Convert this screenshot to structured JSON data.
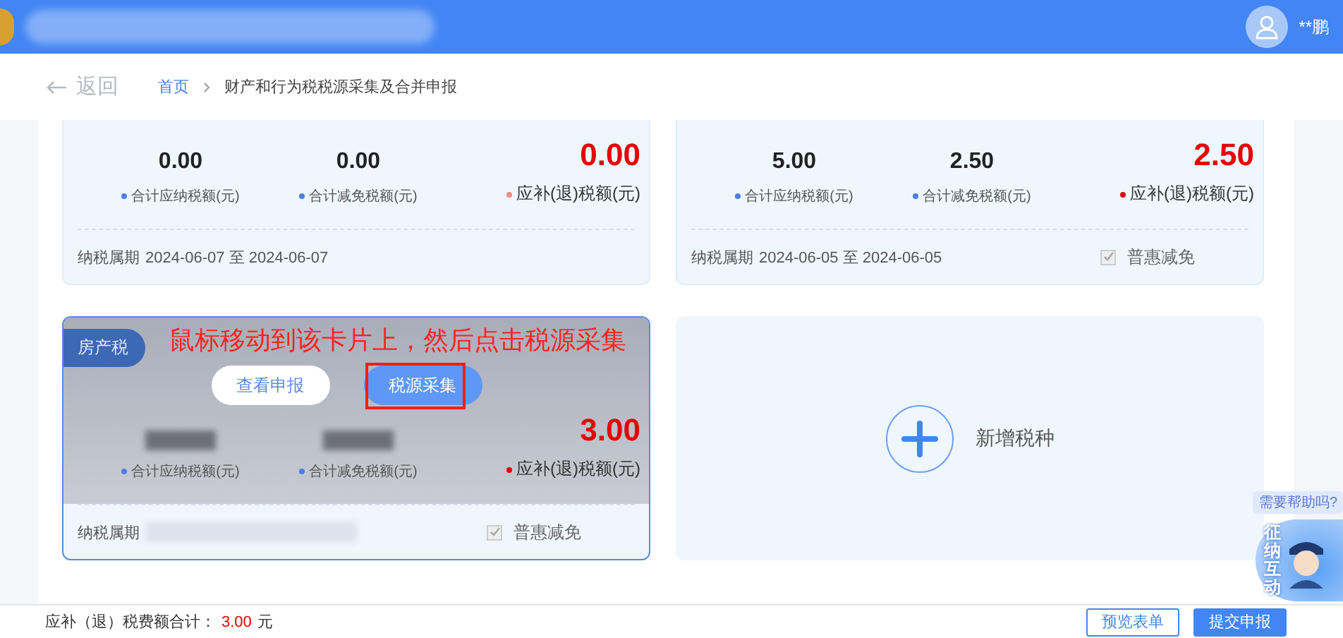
{
  "header": {
    "user_name": "**鹏"
  },
  "back": {
    "label": "返回"
  },
  "breadcrumb": [
    {
      "label": "首页",
      "kind": "link"
    },
    {
      "label": "财产和行为税税源采集及合并申报",
      "kind": "current"
    }
  ],
  "cards": [
    {
      "kind": "tax",
      "hovered": false,
      "payable": "0.00",
      "payable_label": "合计应纳税额(元)",
      "reduced": "0.00",
      "reduced_label": "合计减免税额(元)",
      "due": "0.00",
      "due_label": "应补(退)税额(元)",
      "color": "#f28b82",
      "period_label": "纳税属期",
      "period": "2024-06-07 至 2024-06-07"
    },
    {
      "kind": "tax",
      "hovered": false,
      "payable": "5.00",
      "payable_label": "合计应纳税额(元)",
      "reduced": "2.50",
      "reduced_label": "合计减免税额(元)",
      "due": "2.50",
      "due_label": "应补(退)税额(元)",
      "color": "#e60000",
      "period_label": "纳税属期",
      "period": "2024-06-05 至 2024-06-05",
      "relief": {
        "label": "普惠减免",
        "checked": true
      }
    },
    {
      "kind": "tax",
      "hovered": true,
      "name": "房产税",
      "payable_label": "合计应纳税额(元)",
      "reduced_label": "合计减免税额(元)",
      "due": "3.00",
      "due_label": "应补(退)税额(元)",
      "color": "#e60000",
      "period_label": "纳税属期",
      "relief": {
        "label": "普惠减免",
        "checked": true
      },
      "actions": [
        {
          "label": "查看申报",
          "kind": "secondary",
          "highlighted": false
        },
        {
          "label": "税源采集",
          "kind": "primary",
          "highlighted": true
        }
      ],
      "annotation": {
        "text": "鼠标移动到该卡片上，然后点击税源采集"
      }
    },
    {
      "kind": "add",
      "label": "新增税种"
    }
  ],
  "footer": {
    "total_label": "应补（退）税费额合计：",
    "total": "3.00",
    "unit": "元",
    "buttons": [
      {
        "label": "预览表单",
        "kind": "secondary"
      },
      {
        "label": "提交申报",
        "kind": "primary"
      }
    ]
  },
  "help": {
    "bubble": "需要帮助吗?",
    "label": "征纳互动"
  }
}
